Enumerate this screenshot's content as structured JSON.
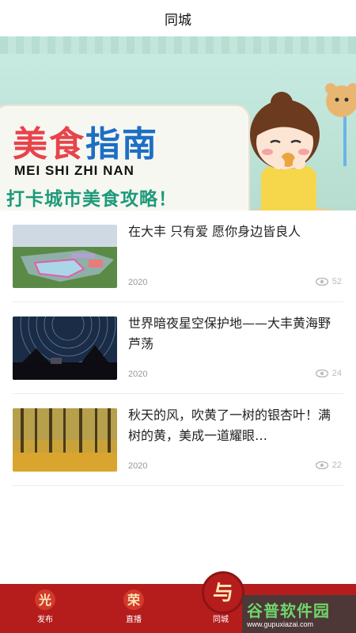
{
  "header": {
    "title": "同城"
  },
  "banner": {
    "title_part1": "美食",
    "title_part2": "指南",
    "pinyin": "MEI SHI ZHI NAN",
    "slogan": "打卡城市美食攻略！",
    "caption": "美食",
    "dot_count": 3,
    "active_dot": 0
  },
  "news": [
    {
      "title": "在大丰 只有爱 愿你身边皆良人",
      "year": "2020",
      "views": "52"
    },
    {
      "title": "世界暗夜星空保护地——大丰黄海野芦荡",
      "year": "2020",
      "views": "24"
    },
    {
      "title": "秋天的风，吹黄了一树的银杏叶！满树的黄，美成一道耀眼…",
      "year": "2020",
      "views": "22"
    }
  ],
  "tabbar": {
    "tabs": [
      {
        "icon_char": "光",
        "label": "发布"
      },
      {
        "icon_char": "荣",
        "label": "直播"
      },
      {
        "icon_char": "与",
        "label": "同城"
      }
    ]
  },
  "watermark": {
    "title": "谷普软件园",
    "url": "www.gupuxiazai.com"
  },
  "colors": {
    "accent": "#b51d1d",
    "banner_red": "#e8434b",
    "banner_blue": "#1d6fc3",
    "banner_green": "#1d9a7a"
  }
}
